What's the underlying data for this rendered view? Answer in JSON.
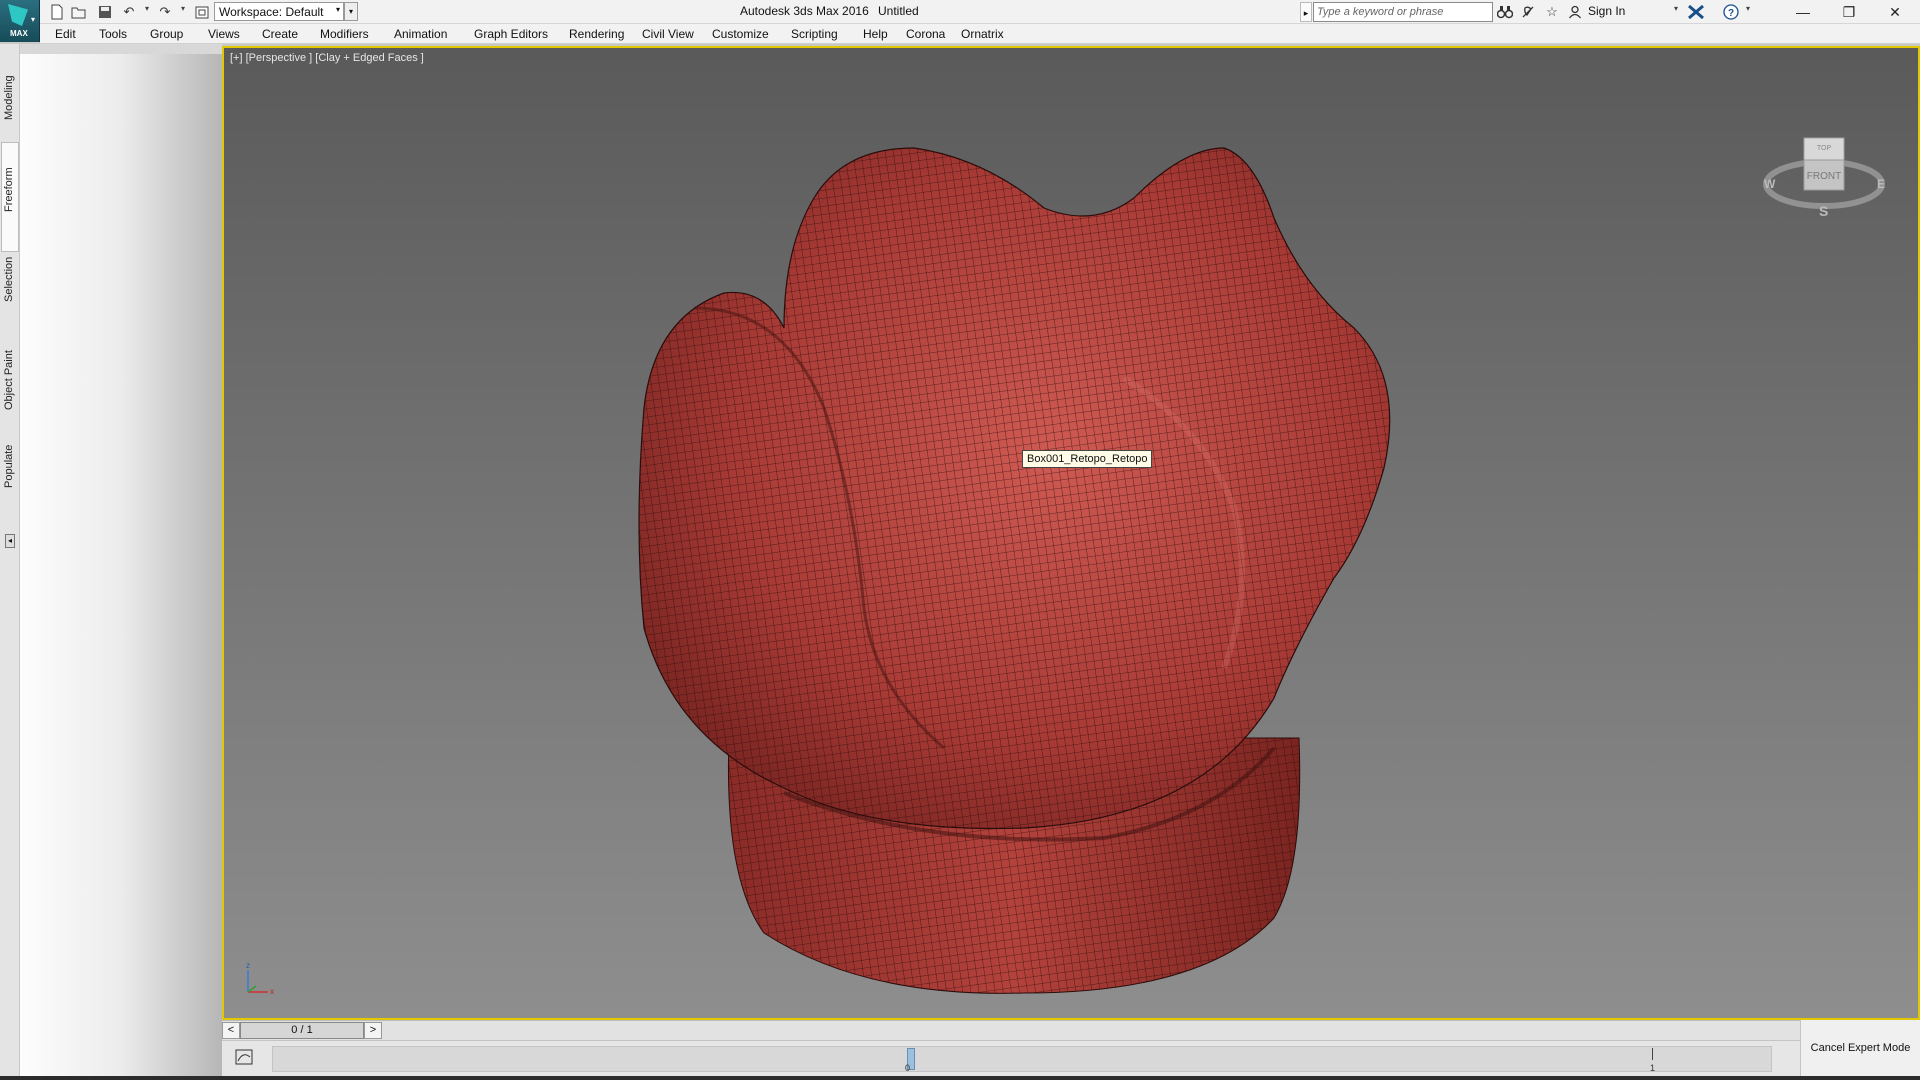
{
  "app": {
    "title": "Autodesk 3ds Max 2016",
    "document": "Untitled",
    "logo_label": "MAX"
  },
  "quick_access": {
    "workspace_label": "Workspace: Default",
    "icons": [
      "new-file-icon",
      "open-file-icon",
      "save-icon",
      "undo-icon",
      "redo-icon",
      "project-folder-icon"
    ]
  },
  "search": {
    "placeholder": "Type a keyword or phrase"
  },
  "account": {
    "sign_in_label": "Sign In"
  },
  "menu": {
    "items": [
      "Edit",
      "Tools",
      "Group",
      "Views",
      "Create",
      "Modifiers",
      "Animation",
      "Graph Editors",
      "Rendering",
      "Civil View",
      "Customize",
      "Scripting",
      "Help",
      "Corona",
      "Ornatrix"
    ]
  },
  "ribbon_tabs": [
    "Modeling",
    "Freeform",
    "Selection",
    "Object Paint",
    "Populate"
  ],
  "active_ribbon_tab": "Freeform",
  "viewport": {
    "label": "[+] [Perspective ] [Clay + Edged Faces ]",
    "object_tooltip": "Box001_Retopo_Retopo",
    "object_color": "#b03c37",
    "frame_color": "#e2c800",
    "viewcube": {
      "face_label": "FRONT",
      "top_label": "TOP",
      "compass_w": "W",
      "compass_e": "E",
      "compass_s": "S"
    },
    "axis_labels": {
      "z": "z",
      "x": "x"
    }
  },
  "time_slider": {
    "frame_display": "0 / 1",
    "prev": "<",
    "next": ">"
  },
  "trackbar": {
    "tick_labels": [
      "0",
      "1"
    ]
  },
  "status": {
    "cancel_expert_mode": "Cancel Expert Mode"
  }
}
